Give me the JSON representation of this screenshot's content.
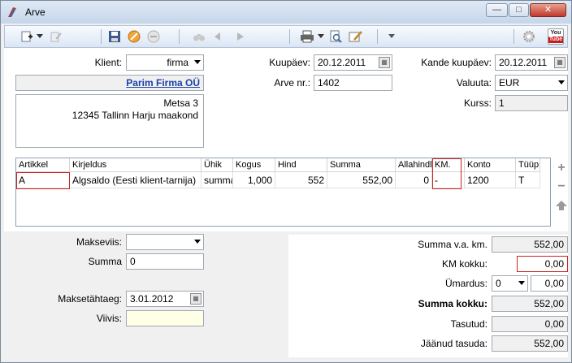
{
  "window": {
    "title": "Arve",
    "min": "—",
    "max": "□",
    "close": "✕"
  },
  "toolbar": {
    "youtube_top": "You",
    "youtube_bottom": "Tube"
  },
  "header": {
    "klient_label": "Klient:",
    "klient_type": "firma",
    "company_name": "Parim Firma OÜ",
    "address_line1": "Metsa 3",
    "address_line2": "12345 Tallinn Harju maakond",
    "kuupaev_label": "Kuupäev:",
    "kuupaev": "20.12.2011",
    "arve_nr_label": "Arve nr.:",
    "arve_nr": "1402",
    "kande_label": "Kande kuupäev:",
    "kande_kuupaev": "20.12.2011",
    "valuuta_label": "Valuuta:",
    "valuuta": "EUR",
    "kurss_label": "Kurss:",
    "kurss": "1"
  },
  "table": {
    "columns": [
      "Artikkel",
      "Kirjeldus",
      "Ühik",
      "Kogus",
      "Hind",
      "Summa",
      "Allahindlus",
      "KM.",
      "Konto",
      "Tüüp"
    ],
    "rows": [
      [
        "A",
        "Algsaldo (Eesti klient-tarnija)",
        "summa",
        "1,000",
        "552",
        "552,00",
        "0",
        "-",
        "1200",
        "T"
      ]
    ]
  },
  "payment": {
    "makseviis_label": "Makseviis:",
    "makseviis": "",
    "summa_label": "Summa",
    "summa": "0",
    "tahtaeg_label": "Maksetähtaeg:",
    "tahtaeg": "3.01.2012",
    "viivis_label": "Viivis:",
    "viivis": ""
  },
  "totals": {
    "summa_va_label": "Summa v.a. km.",
    "summa_va": "552,00",
    "km_label": "KM kokku:",
    "km": "0,00",
    "umardus_label": "Ümardus:",
    "umardus_sel": "0",
    "umardus": "0,00",
    "kokku_label": "Summa kokku:",
    "kokku": "552,00",
    "tasutud_label": "Tasutud:",
    "tasutud": "0,00",
    "jaanud_label": "Jäänud tasuda:",
    "jaanud": "552,00"
  },
  "colors": {
    "link": "#1a3faa",
    "highlight_border": "#cc2222",
    "viivis_bg": "#ffffe8"
  }
}
